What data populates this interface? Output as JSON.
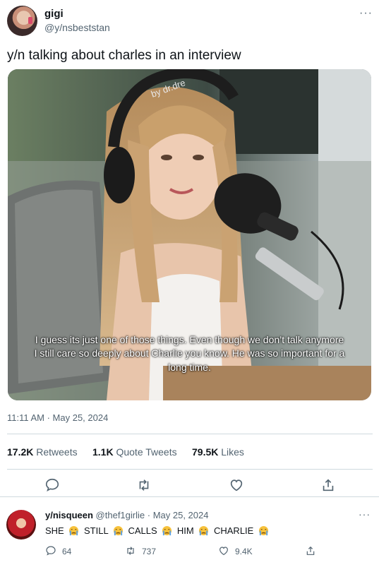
{
  "tweet": {
    "author_name": "gigi",
    "author_handle": "@y/nsbeststan",
    "text": "y/n talking about charles in an interview",
    "media": {
      "caption_line1": "I guess its just one of those things. Even though we don’t talk anymore",
      "caption_line2": "I still care so deeply about Charlie you know. He was so important for a",
      "caption_line3": "long time.",
      "headphone_brand": "by dr.dre"
    },
    "timestamp": "11:11 AM · May 25, 2024",
    "stats": {
      "retweets_count": "17.2K",
      "retweets_label": "Retweets",
      "quotes_count": "1.1K",
      "quotes_label": "Quote Tweets",
      "likes_count": "79.5K",
      "likes_label": "Likes"
    },
    "more_label": "···",
    "icons": [
      "reply-icon",
      "retweet-icon",
      "like-icon",
      "share-icon"
    ]
  },
  "reply": {
    "author_name": "y/nisqueen",
    "author_handle": "@thef1girlie",
    "date": "· May 25, 2024",
    "more_label": "···",
    "words": [
      "SHE",
      "STILL",
      "CALLS",
      "HIM",
      "CHARLIE"
    ],
    "emoji": "crying-face-icon",
    "replies": "64",
    "retweets": "737",
    "likes": "9.4K"
  },
  "colors": {
    "text": "#0f1419",
    "muted": "#536471",
    "divider": "#cfd9de",
    "emoji_yellow": "#f7c23c",
    "emoji_tears": "#5aa0e6"
  }
}
